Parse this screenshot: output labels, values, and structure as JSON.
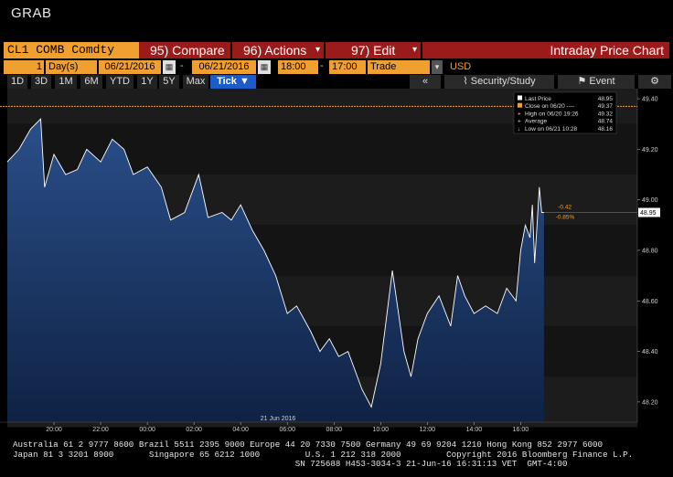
{
  "title": "GRAB",
  "command_bar": {
    "ticker": "CL1 COMB Comdty",
    "compare": {
      "num": "95)",
      "label": "Compare"
    },
    "actions": {
      "num": "96)",
      "label": "Actions"
    },
    "edit": {
      "num": "97)",
      "label": "Edit"
    },
    "chart_title": "Intraday Price Chart"
  },
  "settings": {
    "period_count": "1",
    "period_unit": "Day(s)",
    "start_date": "06/21/2016",
    "end_date": "06/21/2016",
    "start_time": "18:00",
    "end_time": "17:00",
    "event_type": "Trade",
    "currency": "USD",
    "date_sep": "-",
    "time_sep": "-"
  },
  "range_tabs": [
    "1D",
    "3D",
    "1M",
    "6M",
    "YTD",
    "1Y",
    "5Y",
    "Max"
  ],
  "interval": "Tick",
  "toolbar": {
    "back": "«",
    "security_study": "Security/Study",
    "event": "Event",
    "settings_icon": "gear-icon"
  },
  "legend": [
    {
      "label": "Last Price",
      "value": "48.95"
    },
    {
      "label": "Close on 06/20 ----",
      "value": "49.37"
    },
    {
      "label": "High on 06/20 19:26",
      "value": "49.32"
    },
    {
      "label": "Average",
      "value": "48.74"
    },
    {
      "label": "Low on 06/21 10:28",
      "value": "48.16"
    }
  ],
  "last_price_tag": "48.95",
  "change": {
    "abs": "-0.42",
    "pct": "-0.85%"
  },
  "date_marker": "21 Jun 2016",
  "colors": {
    "area": "#1a3566",
    "line": "#ffffff",
    "close_line": "#f0a030",
    "command_red": "#9b1b1b",
    "orange": "#f0a030"
  },
  "chart_data": {
    "type": "area",
    "yticks": [
      "49.40",
      "49.20",
      "49.00",
      "48.80",
      "48.60",
      "48.40",
      "48.20"
    ],
    "ylim": [
      48.12,
      49.44
    ],
    "xticks": [
      "20:00",
      "22:00",
      "00:00",
      "02:00",
      "04:00",
      "06:00",
      "08:00",
      "10:00",
      "12:00",
      "14:00",
      "16:00"
    ],
    "x_hours": [
      18,
      18.5,
      19,
      19.43,
      19.6,
      20,
      20.5,
      21,
      21.4,
      22,
      22.5,
      23,
      23.4,
      24,
      24.6,
      25,
      25.6,
      26.2,
      26.6,
      27.2,
      27.6,
      28,
      28.5,
      29,
      29.5,
      30,
      30.4,
      31,
      31.4,
      31.8,
      32.2,
      32.6,
      33.2,
      33.6,
      34,
      34.5,
      35,
      35.3,
      35.6,
      36,
      36.5,
      37,
      37.3,
      37.6,
      38,
      38.5,
      39,
      39.4,
      39.8,
      40,
      40.2,
      40.4,
      40.5,
      40.6,
      40.7,
      40.8,
      40.9,
      41
    ],
    "values": [
      49.15,
      49.2,
      49.28,
      49.32,
      49.05,
      49.18,
      49.1,
      49.12,
      49.2,
      49.15,
      49.24,
      49.2,
      49.1,
      49.13,
      49.05,
      48.92,
      48.95,
      49.1,
      48.93,
      48.95,
      48.92,
      48.98,
      48.88,
      48.8,
      48.7,
      48.55,
      48.58,
      48.48,
      48.4,
      48.45,
      48.38,
      48.4,
      48.25,
      48.18,
      48.35,
      48.72,
      48.4,
      48.3,
      48.45,
      48.55,
      48.62,
      48.5,
      48.7,
      48.62,
      48.55,
      48.58,
      48.55,
      48.65,
      48.6,
      48.8,
      48.9,
      48.85,
      48.98,
      48.75,
      48.9,
      49.05,
      48.95,
      48.95
    ],
    "close_value": 49.37
  },
  "footer": {
    "line1": "Australia 61 2 9777 8600 Brazil 5511 2395 9000 Europe 44 20 7330 7500 Germany 49 69 9204 1210 Hong Kong 852 2977 6000",
    "line2": "Japan 81 3 3201 8900       Singapore 65 6212 1000         U.S. 1 212 318 2000         Copyright 2016 Bloomberg Finance L.P.",
    "line3": "                                                        SN 725688 H453-3034-3 21-Jun-16 16:31:13 VET  GMT-4:00"
  }
}
